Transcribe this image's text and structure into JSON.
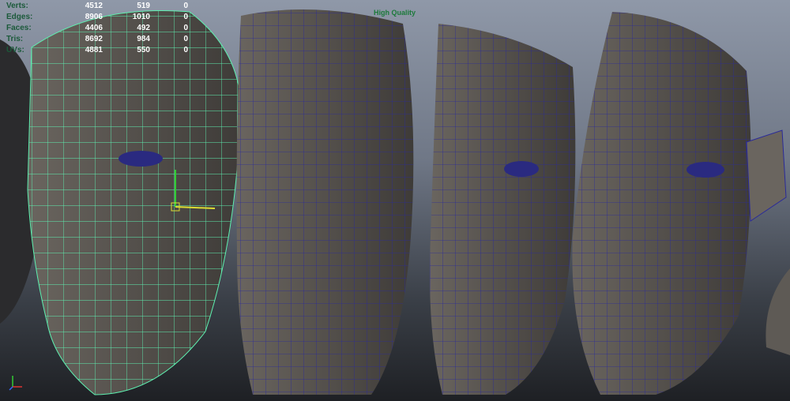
{
  "hud": {
    "rows": [
      {
        "label": "Verts:",
        "a": "4512",
        "b": "519",
        "c": "0"
      },
      {
        "label": "Edges:",
        "a": "8906",
        "b": "1010",
        "c": "0"
      },
      {
        "label": "Faces:",
        "a": "4406",
        "b": "492",
        "c": "0"
      },
      {
        "label": "Tris:",
        "a": "8692",
        "b": "984",
        "c": "0"
      },
      {
        "label": "UVs:",
        "a": "4881",
        "b": "550",
        "c": "0"
      }
    ]
  },
  "viewport": {
    "quality_label": "High Quality"
  },
  "colors": {
    "wire_selected": "#5ef0b0",
    "wire": "#2a2a9a",
    "mesh": "#5e5a55"
  }
}
